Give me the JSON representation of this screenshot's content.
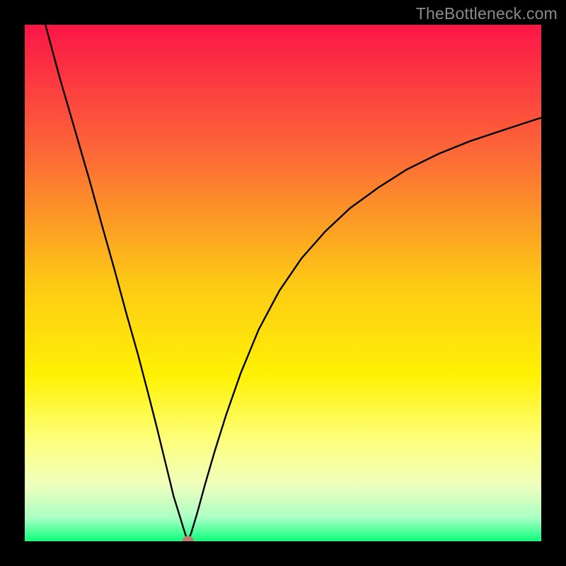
{
  "watermark": "TheBottleneck.com",
  "colors": {
    "frame": "#000000",
    "curve": "#000000",
    "marker": "#bb7f72",
    "gradient_stops": [
      {
        "pos": 0.0,
        "color": "#fb1547"
      },
      {
        "pos": 0.25,
        "color": "#fc6937"
      },
      {
        "pos": 0.5,
        "color": "#fdc915"
      },
      {
        "pos": 0.68,
        "color": "#fff204"
      },
      {
        "pos": 0.8,
        "color": "#feff79"
      },
      {
        "pos": 0.89,
        "color": "#f0ffbd"
      },
      {
        "pos": 0.955,
        "color": "#a9ffc4"
      },
      {
        "pos": 1.0,
        "color": "#0bff7b"
      }
    ]
  },
  "chart_data": {
    "type": "line",
    "title": "",
    "xlabel": "",
    "ylabel": "",
    "xlim": [
      0,
      100
    ],
    "ylim": [
      0,
      100
    ],
    "series": [
      {
        "name": "bottleneck-curve",
        "x": [
          4.0,
          6.7,
          9.6,
          12.5,
          15.0,
          17.4,
          19.7,
          21.9,
          23.8,
          25.5,
          26.8,
          27.9,
          28.8,
          29.9,
          30.7,
          31.2,
          31.6,
          32.2,
          33.4,
          34.9,
          36.8,
          39.0,
          41.8,
          45.3,
          49.3,
          53.6,
          58.2,
          63.0,
          68.5,
          74.0,
          80.1,
          86.3,
          93.2,
          100.0
        ],
        "y": [
          100.0,
          90.0,
          80.0,
          70.0,
          61.0,
          52.5,
          44.0,
          36.2,
          29.0,
          22.3,
          17.0,
          12.5,
          8.8,
          5.2,
          2.6,
          1.0,
          0.2,
          1.5,
          5.5,
          11.0,
          17.5,
          24.5,
          32.5,
          41.0,
          48.5,
          54.8,
          60.0,
          64.5,
          68.5,
          72.0,
          75.0,
          77.5,
          79.8,
          82.0
        ]
      }
    ],
    "marker": {
      "x": 31.6,
      "y": 0.2
    }
  }
}
